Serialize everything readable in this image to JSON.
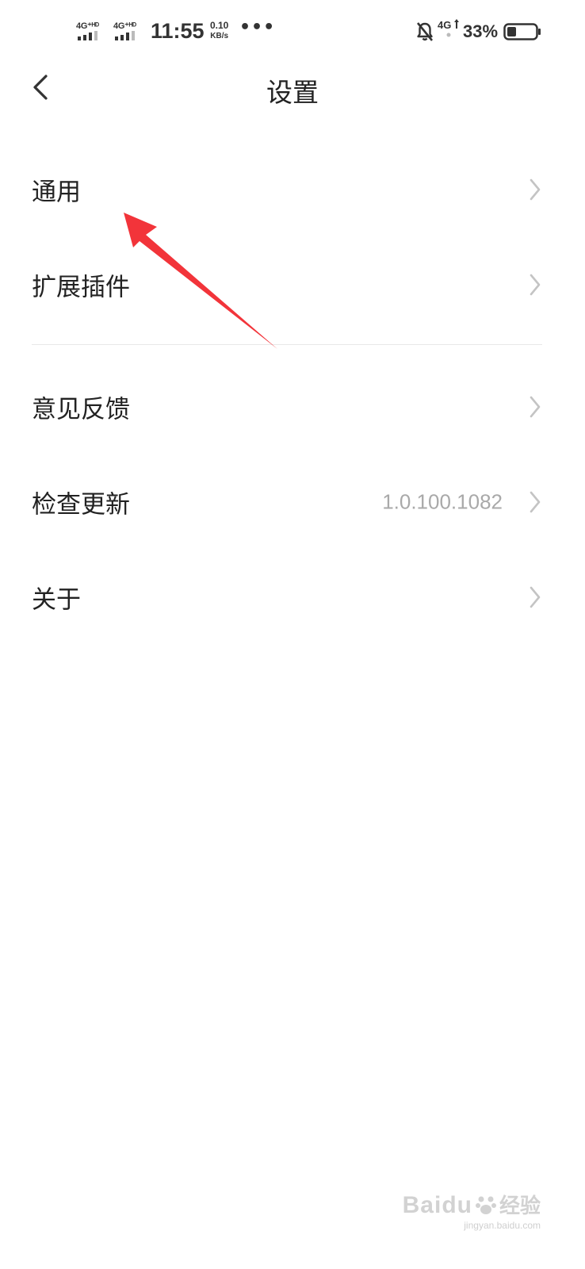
{
  "status_bar": {
    "sim1_label": "4G⁺ᴴᴰ",
    "sim2_label": "4G⁺ᴴᴰ",
    "time": "11:55",
    "speed_value": "0.10",
    "speed_unit": "KB/s",
    "more": "•••",
    "network_right": "4G",
    "battery_percent": "33%",
    "battery_level": 0.33
  },
  "header": {
    "title": "设置"
  },
  "settings": {
    "items": [
      {
        "label": "通用",
        "value": ""
      },
      {
        "label": "扩展插件",
        "value": ""
      },
      {
        "label": "意见反馈",
        "value": ""
      },
      {
        "label": "检查更新",
        "value": "1.0.100.1082"
      },
      {
        "label": "关于",
        "value": ""
      }
    ]
  },
  "annotation": {
    "color": "#f2343a"
  },
  "watermark": {
    "brand": "Baidu",
    "suffix": "经验",
    "url": "jingyan.baidu.com"
  },
  "colors": {
    "background": "#ffffff",
    "text": "#222222",
    "secondary_text": "#a9a9a9",
    "chevron": "#c4c4c4",
    "divider": "#e8e8e8"
  }
}
